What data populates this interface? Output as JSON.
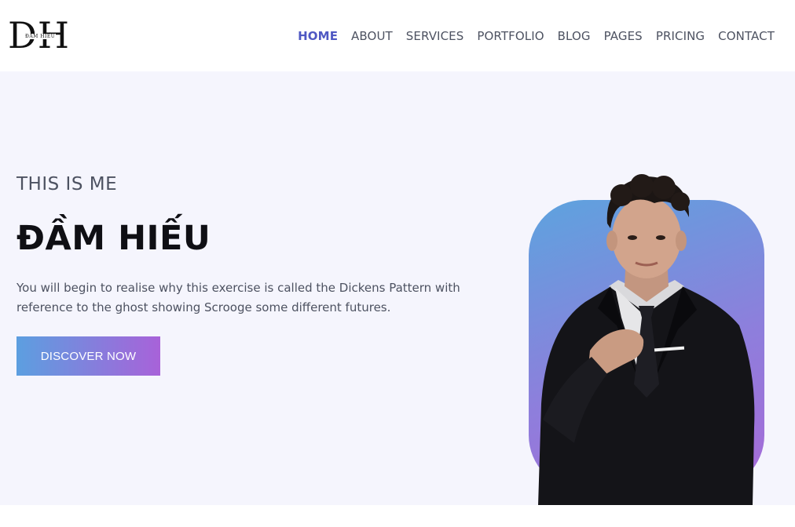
{
  "brand": {
    "logo_text": "DH",
    "logo_subtitle": "ĐẦM HIẾU"
  },
  "nav": {
    "items": [
      {
        "label": "HOME",
        "active": true
      },
      {
        "label": "ABOUT",
        "active": false
      },
      {
        "label": "SERVICES",
        "active": false
      },
      {
        "label": "PORTFOLIO",
        "active": false
      },
      {
        "label": "BLOG",
        "active": false
      },
      {
        "label": "PAGES",
        "active": false
      },
      {
        "label": "PRICING",
        "active": false
      },
      {
        "label": "CONTACT",
        "active": false
      }
    ]
  },
  "hero": {
    "eyebrow": "THIS IS ME",
    "title": "ĐẦM HIẾU",
    "description": "You will begin to realise why this exercise is called the Dickens Pattern with reference to the ghost showing Scrooge some different futures.",
    "cta_label": "DISCOVER NOW"
  },
  "colors": {
    "accent": "#4f58c3",
    "gradient_start": "#5c9fe0",
    "gradient_end": "#a862d9",
    "hero_background": "#f5f5fd"
  }
}
